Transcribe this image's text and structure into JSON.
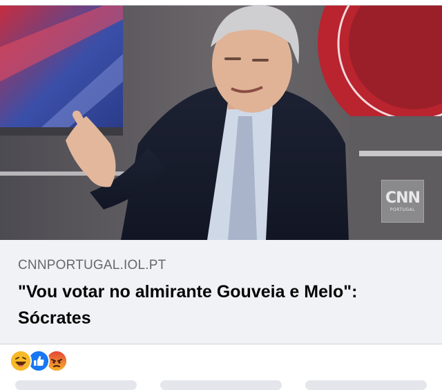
{
  "post": {
    "link_preview": {
      "domain": "CNNPORTUGAL.IOL.PT",
      "headline": "\"Vou votar no almirante Gouveia e Melo\": Sócrates",
      "watermark": {
        "main": "CNN",
        "sub": "PORTUGAL"
      }
    },
    "reactions": [
      {
        "icon": "haha-icon",
        "color": "#f7b928"
      },
      {
        "icon": "like-icon",
        "color": "#1877f2"
      },
      {
        "icon": "angry-icon",
        "color": "#e9710f"
      }
    ]
  }
}
